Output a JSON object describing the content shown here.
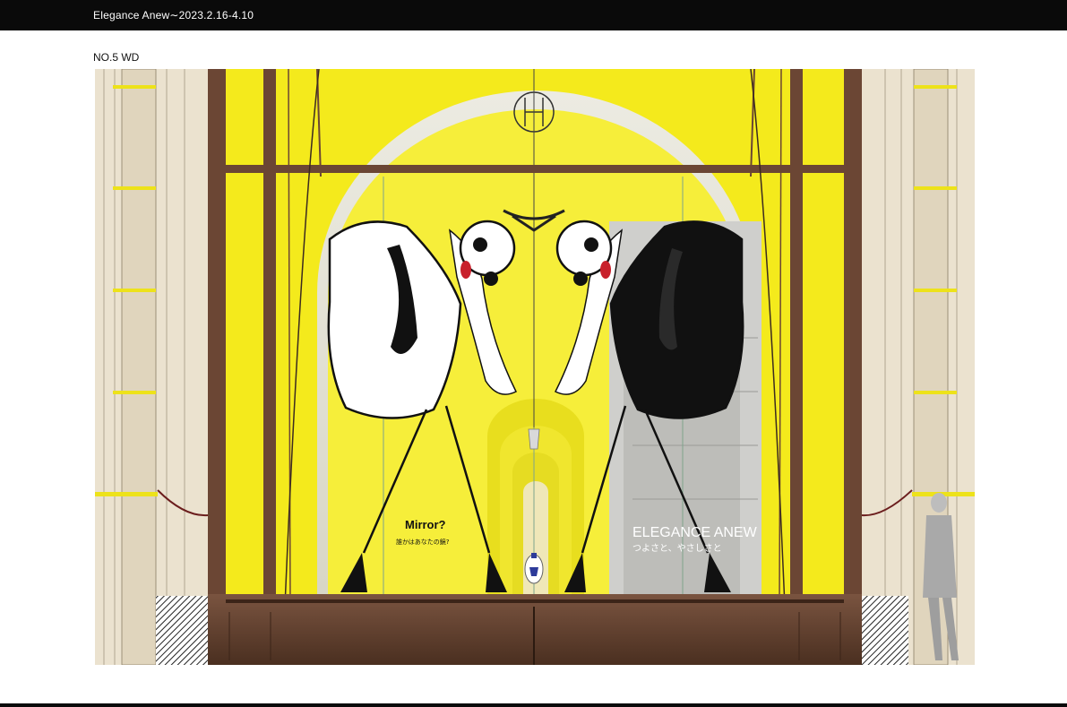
{
  "header": {
    "title": "Elegance Anew∼2023.2.16-4.10"
  },
  "drawing": {
    "label": "NO.5 WD",
    "left_text": {
      "title": "Mirror?",
      "subtitle": "誰かはあなたの鏡?"
    },
    "right_text": {
      "title": "ELEGANCE ANEW",
      "subtitle": "つよさと、やさしさと"
    }
  },
  "colors": {
    "header_bg": "#0a0a0a",
    "backdrop_yellow": "#f4ea1c",
    "frame_brown": "#6b4634",
    "base_brown": "#5a3a28",
    "facade_cream": "#ebe2cf",
    "figure_black": "#111111",
    "lip_red": "#c8202b"
  },
  "icons": [
    "crest-icon",
    "perfume-bottle-icon",
    "chandelier-icon"
  ]
}
